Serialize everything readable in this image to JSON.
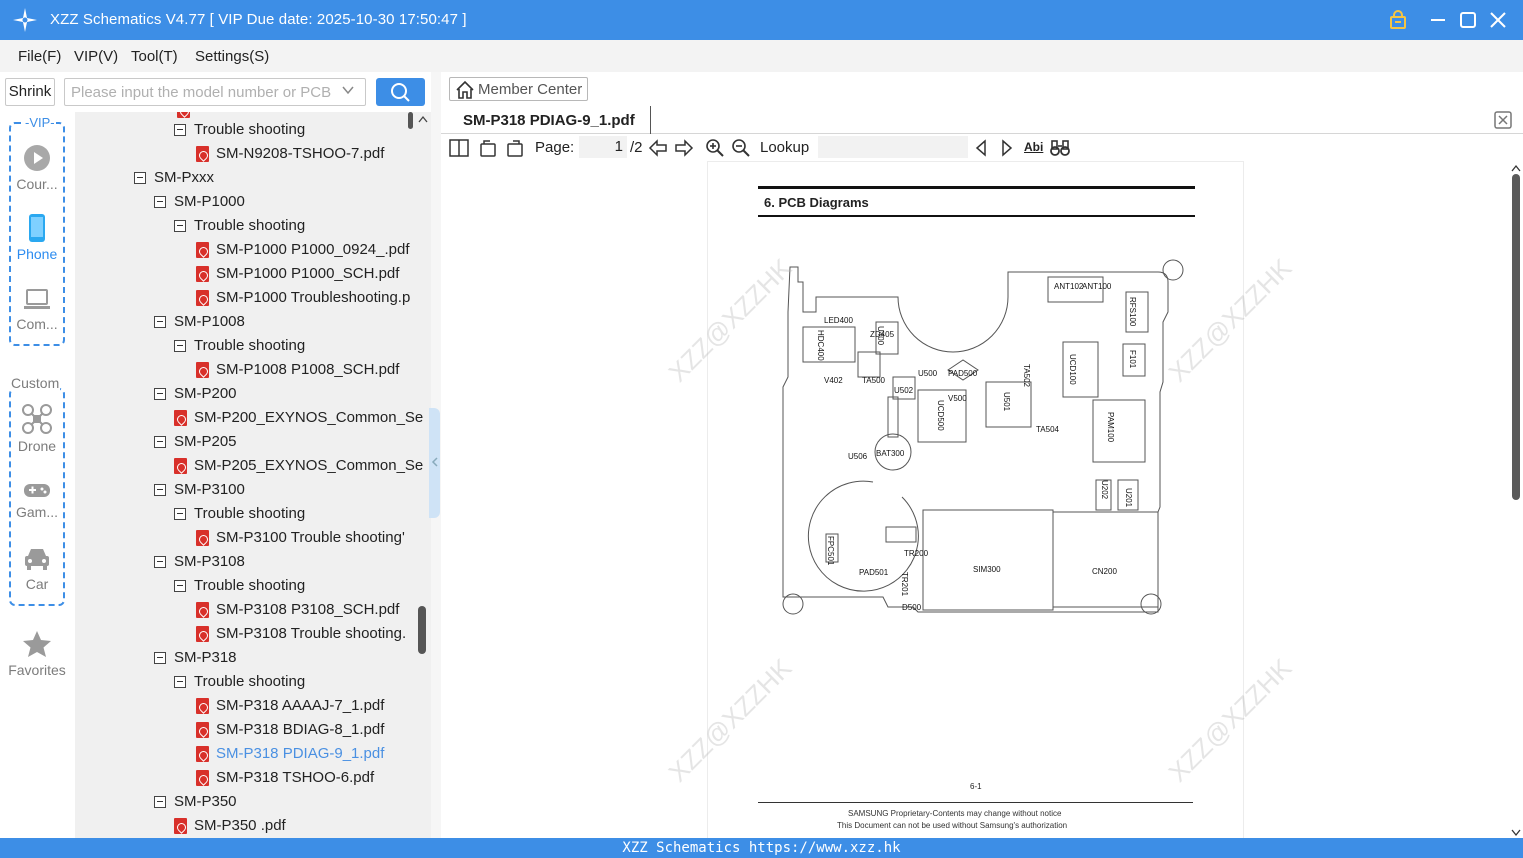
{
  "app": {
    "title": "XZZ Schematics V4.77 [ VIP Due date: 2025-10-30 17:50:47 ]",
    "accent_color": "#3d8ee6",
    "window_icons": [
      "lock-icon",
      "minimize-icon",
      "maximize-icon",
      "close-icon"
    ]
  },
  "menu": [
    "File(F)",
    "VIP(V)",
    "Tool(T)",
    "Settings(S)"
  ],
  "search": {
    "shrink_label": "Shrink",
    "placeholder": "Please input the model number or PCB"
  },
  "sidebar": {
    "vip_label": "-VIP-",
    "custom_label": "Custom",
    "items": [
      {
        "label": "Cour...",
        "icon": "play-circle-icon"
      },
      {
        "label": "Phone",
        "icon": "phone-icon",
        "active": true
      },
      {
        "label": "Com...",
        "icon": "laptop-icon"
      },
      {
        "label": "Drone",
        "icon": "drone-icon"
      },
      {
        "label": "Gam...",
        "icon": "gamepad-icon"
      },
      {
        "label": "Car",
        "icon": "car-icon"
      },
      {
        "label": "Favorites",
        "icon": "star-icon"
      }
    ]
  },
  "tree": {
    "rows": [
      {
        "type": "folder",
        "label": "Trouble shooting",
        "level": 2
      },
      {
        "type": "pdf",
        "label": "SM-N9208-TSHOO-7.pdf",
        "level": 3
      },
      {
        "type": "folder",
        "label": "SM-Pxxx",
        "level": 0
      },
      {
        "type": "folder",
        "label": "SM-P1000",
        "level": 1
      },
      {
        "type": "folder",
        "label": "Trouble shooting",
        "level": 2
      },
      {
        "type": "pdf",
        "label": "SM-P1000 P1000_0924_.pdf",
        "level": 3
      },
      {
        "type": "pdf",
        "label": "SM-P1000 P1000_SCH.pdf",
        "level": 3
      },
      {
        "type": "pdf",
        "label": "SM-P1000 Troubleshooting.p",
        "level": 3
      },
      {
        "type": "folder",
        "label": "SM-P1008",
        "level": 1
      },
      {
        "type": "folder",
        "label": "Trouble shooting",
        "level": 2
      },
      {
        "type": "pdf",
        "label": "SM-P1008 P1008_SCH.pdf",
        "level": 3
      },
      {
        "type": "folder",
        "label": "SM-P200",
        "level": 1
      },
      {
        "type": "pdf",
        "label": "SM-P200_EXYNOS_Common_Se",
        "level": 2
      },
      {
        "type": "folder",
        "label": "SM-P205",
        "level": 1
      },
      {
        "type": "pdf",
        "label": "SM-P205_EXYNOS_Common_Se",
        "level": 2
      },
      {
        "type": "folder",
        "label": "SM-P3100",
        "level": 1
      },
      {
        "type": "folder",
        "label": "Trouble shooting",
        "level": 2
      },
      {
        "type": "pdf",
        "label": "SM-P3100 Trouble shooting'",
        "level": 3
      },
      {
        "type": "folder",
        "label": "SM-P3108",
        "level": 1
      },
      {
        "type": "folder",
        "label": "Trouble shooting",
        "level": 2
      },
      {
        "type": "pdf",
        "label": "SM-P3108 P3108_SCH.pdf",
        "level": 3
      },
      {
        "type": "pdf",
        "label": "SM-P3108 Trouble shooting.",
        "level": 3
      },
      {
        "type": "folder",
        "label": "SM-P318",
        "level": 1
      },
      {
        "type": "folder",
        "label": "Trouble shooting",
        "level": 2
      },
      {
        "type": "pdf",
        "label": "SM-P318 AAAAJ-7_1.pdf",
        "level": 3
      },
      {
        "type": "pdf",
        "label": "SM-P318 BDIAG-8_1.pdf",
        "level": 3
      },
      {
        "type": "pdf",
        "label": "SM-P318 PDIAG-9_1.pdf",
        "level": 3,
        "selected": true
      },
      {
        "type": "pdf",
        "label": "SM-P318 TSHOO-6.pdf",
        "level": 3
      },
      {
        "type": "folder",
        "label": "SM-P350",
        "level": 1
      },
      {
        "type": "pdf",
        "label": "SM-P350 .pdf",
        "level": 2
      }
    ]
  },
  "viewer": {
    "member_center": "Member Center",
    "tab": "SM-P318 PDIAG-9_1.pdf",
    "page_label": "Page:",
    "page_current": "1",
    "page_total": "/2",
    "lookup_label": "Lookup",
    "lookup_value": "",
    "find_icon_label": "Abi",
    "doc": {
      "heading": "6.  PCB  Diagrams",
      "page_num": "6-1",
      "footer1": "SAMSUNG Proprietary-Contents may change without notice",
      "footer2": "This Document can not be used without Samsung's authorization",
      "watermark": "XZZ@XZZHK",
      "components": [
        "LED400",
        "ZD405",
        "HDC400",
        "U400",
        "U500",
        "PAD500",
        "TA502",
        "UCD100",
        "F101",
        "RFS100",
        "ANT102",
        "ANT100",
        "TA500",
        "U502",
        "V402",
        "U501",
        "UCD500",
        "V500",
        "TA504",
        "PAM100",
        "BAT300",
        "U506",
        "U202",
        "U201",
        "SIM300",
        "CN200",
        "FPC501",
        "PAD501",
        "TR200",
        "TR201",
        "D500"
      ]
    }
  },
  "status": "XZZ Schematics https://www.xzz.hk"
}
